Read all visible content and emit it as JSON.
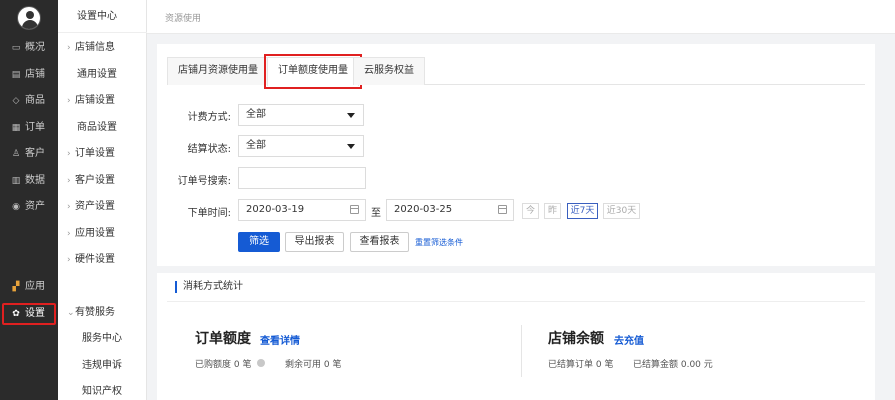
{
  "nav1": {
    "items": [
      {
        "icon": "▭",
        "label": "概况"
      },
      {
        "icon": "▤",
        "label": "店铺"
      },
      {
        "icon": "◇",
        "label": "商品"
      },
      {
        "icon": "▦",
        "label": "订单"
      },
      {
        "icon": "♙",
        "label": "客户"
      },
      {
        "icon": "▥",
        "label": "数据"
      },
      {
        "icon": "◉",
        "label": "资产"
      },
      {
        "icon": "▞",
        "label": "应用"
      },
      {
        "icon": "✿",
        "label": "设置"
      }
    ]
  },
  "nav2": {
    "header": "设置中心",
    "items": [
      {
        "label": "店铺信息"
      },
      {
        "label": "通用设置"
      },
      {
        "label": "店铺设置"
      },
      {
        "label": "商品设置"
      },
      {
        "label": "订单设置"
      },
      {
        "label": "客户设置"
      },
      {
        "label": "资产设置"
      },
      {
        "label": "应用设置"
      },
      {
        "label": "硬件设置"
      },
      {
        "label": "有赞服务"
      },
      {
        "label": "服务中心"
      },
      {
        "label": "违规申诉"
      },
      {
        "label": "知识产权"
      }
    ]
  },
  "breadcrumb": "资源使用",
  "tabs": [
    "店铺月资源使用量",
    "订单额度使用量",
    "云服务权益"
  ],
  "filters": {
    "billing_label": "计费方式:",
    "billing_value": "全部",
    "settle_label": "结算状态:",
    "settle_value": "全部",
    "order_label": "订单号搜索:",
    "order_value": "",
    "time_label": "下单时间:",
    "date_from": "2020-03-19",
    "to": "至",
    "date_to": "2020-03-25",
    "quick": [
      "今",
      "昨",
      "近7天",
      "近30天"
    ]
  },
  "actions": {
    "filter": "筛选",
    "export": "导出报表",
    "view": "查看报表",
    "reset": "重置筛选条件"
  },
  "stats": {
    "section_title": "消耗方式统计",
    "left_title": "订单额度",
    "left_link": "查看详情",
    "purchased": "已购额度 0 笔",
    "remaining": "剩余可用 0 笔",
    "right_title": "店铺余额",
    "right_link": "去充值",
    "settled_orders": "已结算订单 0 笔",
    "settled_amount": "已结算金额 0.00 元"
  },
  "colors": {
    "accent": "#155bd4",
    "highlight": "#e02020",
    "sidebar": "#2b2b2b"
  }
}
